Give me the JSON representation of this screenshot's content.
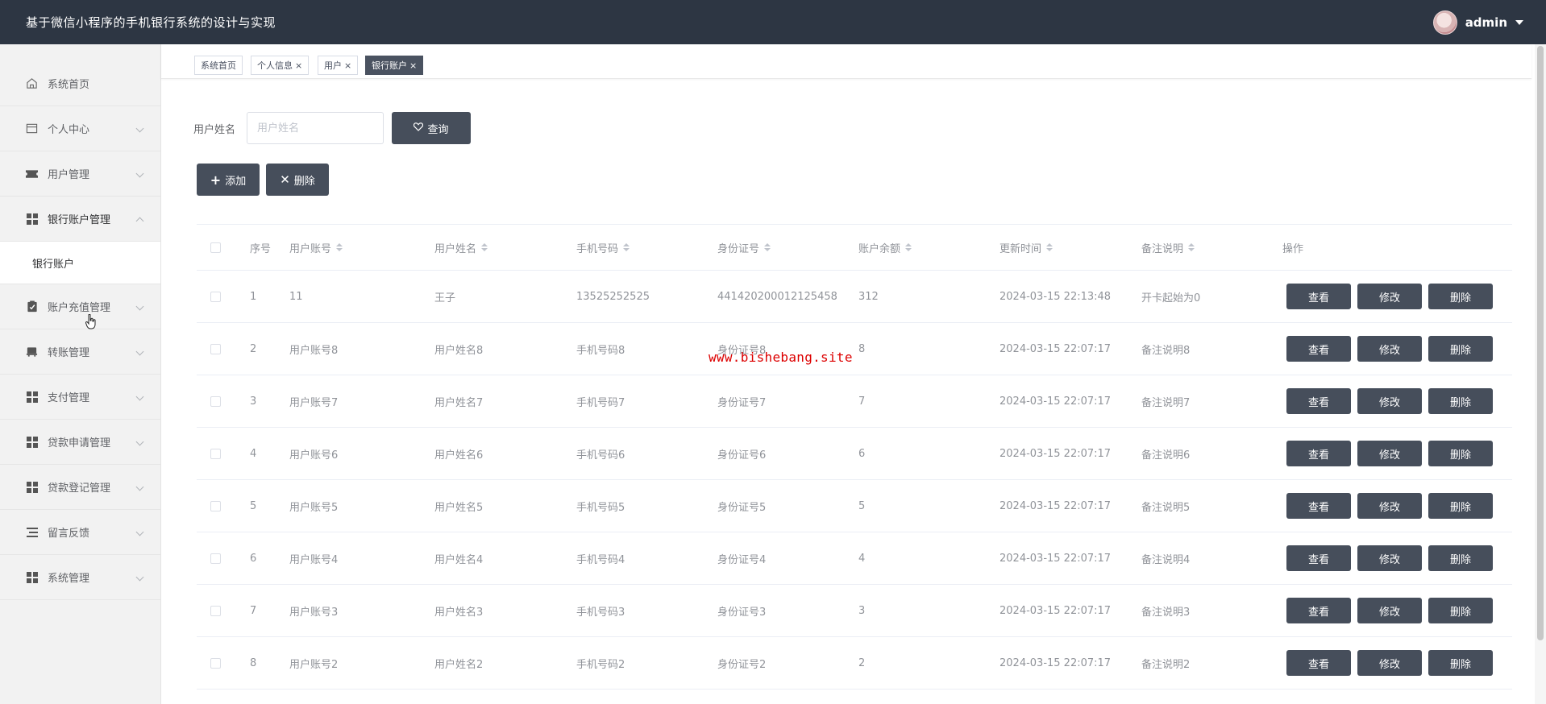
{
  "header": {
    "title": "基于微信小程序的手机银行系统的设计与实现",
    "username": "admin"
  },
  "sidebar": {
    "items": [
      {
        "label": "系统首页",
        "icon": "home-icon",
        "has_arrow": false
      },
      {
        "label": "个人中心",
        "icon": "card-icon",
        "has_arrow": true
      },
      {
        "label": "用户管理",
        "icon": "ticket-icon",
        "has_arrow": true
      },
      {
        "label": "银行账户管理",
        "icon": "grid-icon",
        "has_arrow": true,
        "expanded": true
      },
      {
        "label": "账户充值管理",
        "icon": "clipboard-icon",
        "has_arrow": true
      },
      {
        "label": "转账管理",
        "icon": "truck-icon",
        "has_arrow": true
      },
      {
        "label": "支付管理",
        "icon": "grid-icon",
        "has_arrow": true
      },
      {
        "label": "贷款申请管理",
        "icon": "grid-icon",
        "has_arrow": true
      },
      {
        "label": "贷款登记管理",
        "icon": "grid-icon",
        "has_arrow": true
      },
      {
        "label": "留言反馈",
        "icon": "list-icon",
        "has_arrow": true
      },
      {
        "label": "系统管理",
        "icon": "grid-icon",
        "has_arrow": true
      }
    ],
    "submenu_label": "银行账户"
  },
  "tabs": [
    {
      "label": "系统首页",
      "closable": false
    },
    {
      "label": "个人信息",
      "closable": true
    },
    {
      "label": "用户",
      "closable": true
    },
    {
      "label": "银行账户",
      "closable": true,
      "active": true
    }
  ],
  "search": {
    "label": "用户姓名",
    "placeholder": "用户姓名",
    "query_label": "查询"
  },
  "actions": {
    "add_label": "添加",
    "delete_label": "删除"
  },
  "table": {
    "columns": [
      "序号",
      "用户账号",
      "用户姓名",
      "手机号码",
      "身份证号",
      "账户余额",
      "更新时间",
      "备注说明",
      "操作"
    ],
    "row_buttons": {
      "view": "查看",
      "edit": "修改",
      "delete": "删除"
    },
    "rows": [
      {
        "idx": "1",
        "account": "11",
        "name": "王子",
        "phone": "13525252525",
        "idcard": "441420200012125458",
        "balance": "312",
        "updated": "2024-03-15 22:13:48",
        "note": "开卡起始为0"
      },
      {
        "idx": "2",
        "account": "用户账号8",
        "name": "用户姓名8",
        "phone": "手机号码8",
        "idcard": "身份证号8",
        "balance": "8",
        "updated": "2024-03-15 22:07:17",
        "note": "备注说明8"
      },
      {
        "idx": "3",
        "account": "用户账号7",
        "name": "用户姓名7",
        "phone": "手机号码7",
        "idcard": "身份证号7",
        "balance": "7",
        "updated": "2024-03-15 22:07:17",
        "note": "备注说明7"
      },
      {
        "idx": "4",
        "account": "用户账号6",
        "name": "用户姓名6",
        "phone": "手机号码6",
        "idcard": "身份证号6",
        "balance": "6",
        "updated": "2024-03-15 22:07:17",
        "note": "备注说明6"
      },
      {
        "idx": "5",
        "account": "用户账号5",
        "name": "用户姓名5",
        "phone": "手机号码5",
        "idcard": "身份证号5",
        "balance": "5",
        "updated": "2024-03-15 22:07:17",
        "note": "备注说明5"
      },
      {
        "idx": "6",
        "account": "用户账号4",
        "name": "用户姓名4",
        "phone": "手机号码4",
        "idcard": "身份证号4",
        "balance": "4",
        "updated": "2024-03-15 22:07:17",
        "note": "备注说明4"
      },
      {
        "idx": "7",
        "account": "用户账号3",
        "name": "用户姓名3",
        "phone": "手机号码3",
        "idcard": "身份证号3",
        "balance": "3",
        "updated": "2024-03-15 22:07:17",
        "note": "备注说明3"
      },
      {
        "idx": "8",
        "account": "用户账号2",
        "name": "用户姓名2",
        "phone": "手机号码2",
        "idcard": "身份证号2",
        "balance": "2",
        "updated": "2024-03-15 22:07:17",
        "note": "备注说明2"
      }
    ]
  },
  "watermark": "www.bishebang.site",
  "colors": {
    "header_bg": "#2d3643",
    "button_dark": "#464e5b",
    "active_tab": "#4a5260",
    "sidebar_bg": "#f2f2f2"
  }
}
